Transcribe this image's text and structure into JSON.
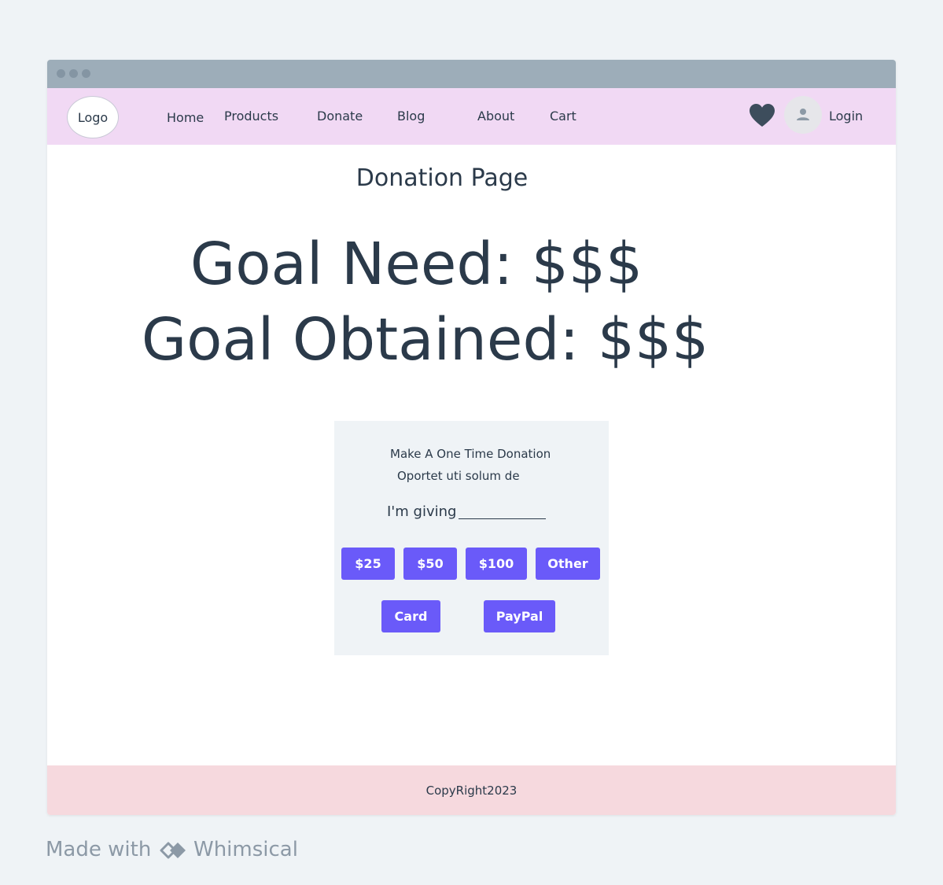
{
  "nav": {
    "logo": "Logo",
    "links": [
      "Home",
      "Products",
      "Donate",
      "Blog",
      "About",
      "Cart"
    ],
    "login": "Login"
  },
  "main": {
    "title": "Donation Page",
    "goal_need": "Goal Need: $$$",
    "goal_obtained": "Goal Obtained: $$$"
  },
  "donation_card": {
    "title": "Make A One Time Donation",
    "subtitle": "Oportet uti solum de",
    "giving_label": "I'm giving",
    "amounts": [
      "$25",
      "$50",
      "$100",
      "Other"
    ],
    "payment_methods": [
      "Card",
      "PayPal"
    ]
  },
  "footer": {
    "copyright": "CopyRight2023"
  },
  "branding": {
    "made_with": "Made with",
    "app_name": "Whimsical"
  },
  "colors": {
    "accent": "#6a5af9",
    "nav_bg": "#f1d9f4",
    "footer_bg": "#f6d9de",
    "titlebar": "#9dadb9"
  },
  "icons": [
    "heart-icon",
    "user-icon",
    "whimsical-logo-icon"
  ]
}
